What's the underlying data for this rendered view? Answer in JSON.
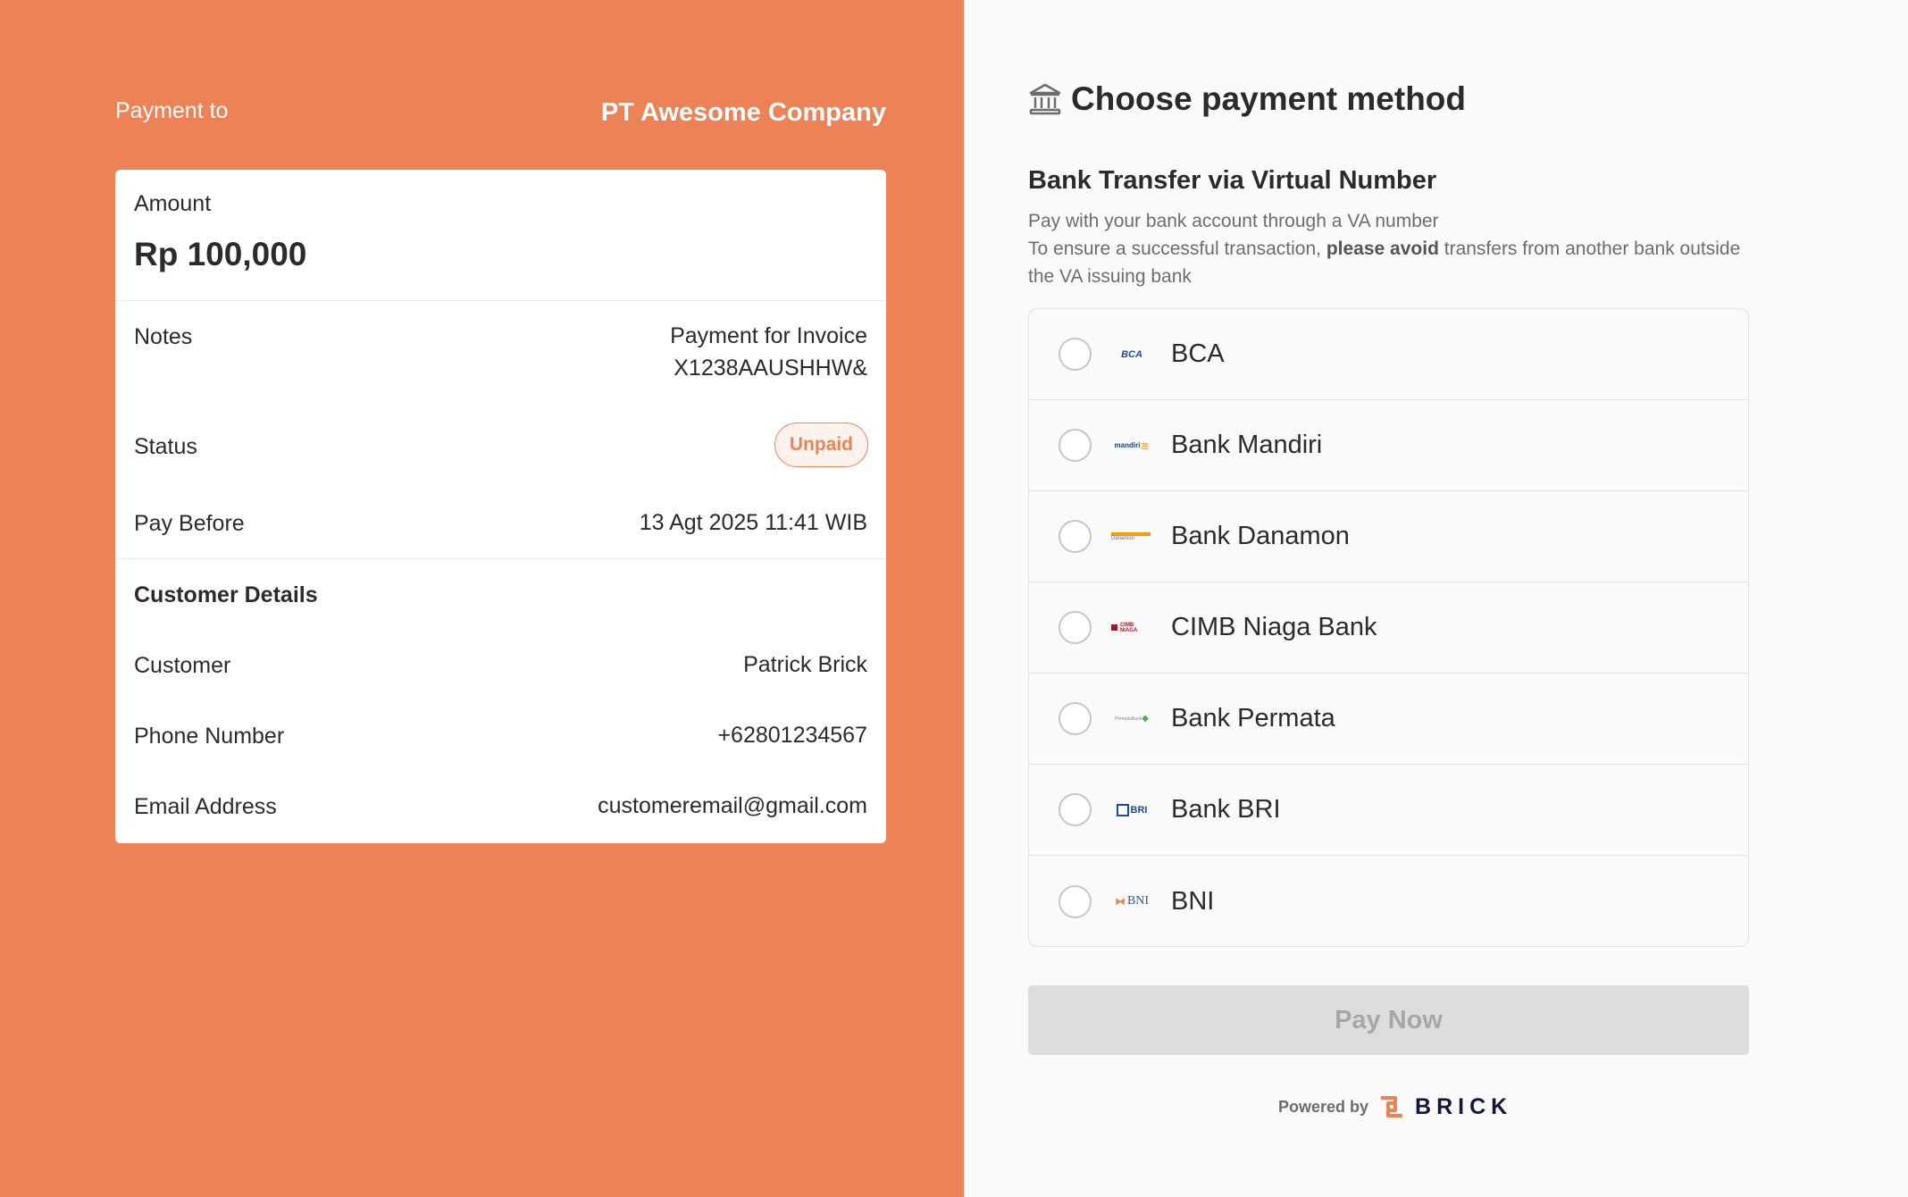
{
  "colors": {
    "accent": "#ee8257",
    "panel_bg": "#fafafa",
    "text": "#2b2b2b",
    "muted": "#6d6d6d",
    "button_disabled": "#dddddd"
  },
  "summary": {
    "payment_to_label": "Payment to",
    "merchant_name": "PT Awesome Company",
    "amount_label": "Amount",
    "amount_value": "Rp 100,000",
    "notes_label": "Notes",
    "notes_value_line1": "Payment for Invoice",
    "notes_value_line2": "X1238AAUSHHW&",
    "status_label": "Status",
    "status_value": "Unpaid",
    "pay_before_label": "Pay Before",
    "pay_before_value": "13 Agt 2025 11:41 WIB",
    "customer_section_title": "Customer Details",
    "customer_label": "Customer",
    "customer_value": "Patrick Brick",
    "phone_label": "Phone Number",
    "phone_value": "+62801234567",
    "email_label": "Email Address",
    "email_value": "customeremail@gmail.com"
  },
  "payment": {
    "heading": "Choose payment method",
    "heading_icon": "bank-icon",
    "method_title": "Bank Transfer via Virtual Number",
    "desc_line1": "Pay with your bank account through a VA number",
    "desc_line2_pre": "To ensure a successful transaction, ",
    "desc_line2_bold": "please avoid",
    "desc_line2_post": " transfers from another bank outside the VA issuing bank",
    "banks": [
      {
        "name": "BCA",
        "logo_icon": "bca-logo-icon",
        "logo_text": "BCA"
      },
      {
        "name": "Bank Mandiri",
        "logo_icon": "mandiri-logo-icon",
        "logo_text": "mandiri"
      },
      {
        "name": "Bank Danamon",
        "logo_icon": "danamon-logo-icon",
        "logo_text": "Danamon"
      },
      {
        "name": "CIMB Niaga Bank",
        "logo_icon": "cimb-niaga-logo-icon",
        "logo_text": "CIMB NIAGA"
      },
      {
        "name": "Bank Permata",
        "logo_icon": "permata-logo-icon",
        "logo_text": "PermataBank"
      },
      {
        "name": "Bank BRI",
        "logo_icon": "bri-logo-icon",
        "logo_text": "BRI"
      },
      {
        "name": "BNI",
        "logo_icon": "bni-logo-icon",
        "logo_text": "BNI"
      }
    ],
    "pay_button_label": "Pay Now"
  },
  "footer": {
    "powered_by": "Powered by",
    "brand": "BRICK"
  }
}
